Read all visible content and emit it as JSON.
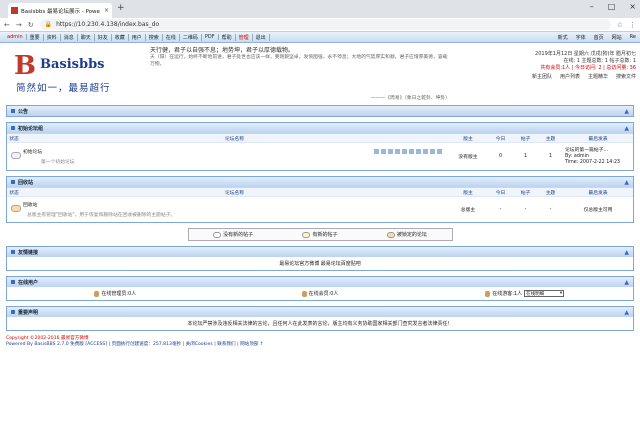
{
  "browser": {
    "tab_title": "Basisbbs 最易论坛展示 - Powe",
    "url": "https://10.230.4.138/index.bas_do"
  },
  "topnav": {
    "items": [
      "admin",
      "重要",
      "资料",
      "消息",
      "聊天",
      "好友",
      "收藏",
      "用户",
      "搜索",
      "在线",
      "二维码",
      "PDF",
      "帮助",
      "管理",
      "退出"
    ],
    "right": [
      "新式",
      "字体",
      "首页",
      "网站",
      "Re"
    ]
  },
  "header": {
    "logo_name": "Basisbbs",
    "logo_slogan": "简然如一，最易超行",
    "motto_line1": "天行健，君子以自强不息；地势坤，君子以厚德载物。",
    "motto_line2": "天（阳）在运行，始终不断地前进，君子处世也应该一样，要刚毅坚卓，发愤图强，永不停息；大地的气势厚实和顺，君子应增厚美德，容载万物。",
    "motto_sig": "———《周易》（象日之乾卦、坤卦）",
    "date": "2019年1月12日 星期六 戊戌(狗)年 腊月初七",
    "stat1": "在线: 1 主题总数: 1 帖子总数: 1",
    "stat2": "共有会员:1人 | 今日访问: 2 | 总访问量: 36",
    "links": [
      "新主团队",
      "用户列表",
      "主题精华",
      "搜索文件"
    ]
  },
  "announce": {
    "title": "公告"
  },
  "columns": {
    "status": "状态",
    "forum": "论坛名称",
    "moderator": "版主",
    "today": "今日",
    "posts": "帖子",
    "topics": "主题",
    "last": "最后发表"
  },
  "cat1": {
    "title": "初始论坛组",
    "forum_name": "初始论坛",
    "forum_desc": "第一个初始论坛",
    "moderator": "没有版主",
    "today": "0",
    "posts": "1",
    "topics": "1",
    "last1": "论坛的第一篇帖子...",
    "last2": "By: admin",
    "last3": "Time: 2007-2-22 14:23"
  },
  "cat2": {
    "title": "回收站",
    "forum_name": "回收站",
    "forum_desc": "总版主有管理\"回收站\"，用于恢复和删除站在回收被删除的主题帖子。",
    "moderator": "总版主",
    "today": "-",
    "posts": "-",
    "topics": "-",
    "last": "仅总版主可用"
  },
  "legend": [
    "没有新的帖子",
    "有新的帖子",
    "被锁定的论坛"
  ],
  "links_section": {
    "title": "友情链接",
    "text": "最易论坛官方微博  最易论坛百度贴吧"
  },
  "online": {
    "title": "在线用户",
    "admins": "在线管理员:0人",
    "members": "在线会员:0人",
    "guests": "在线游客:1人",
    "select": "在线明细"
  },
  "disclaimer": {
    "title": "重要声明",
    "text": "本论坛严禁涉及违反相关法律的言论，且任何人在此发表的言论，版主均有义务协助国家相关部门查究发言者法律责任！"
  },
  "footer": {
    "line1": "Copyright ©2002-2016 最易官方微博",
    "line2": "Powered By BasisBBS 2.7.0 免费版 [ACCESS] | 页面执行创建速度：257.813毫秒 | 关闭Cookies | 联系我们 | 网站顶部 ↑"
  }
}
